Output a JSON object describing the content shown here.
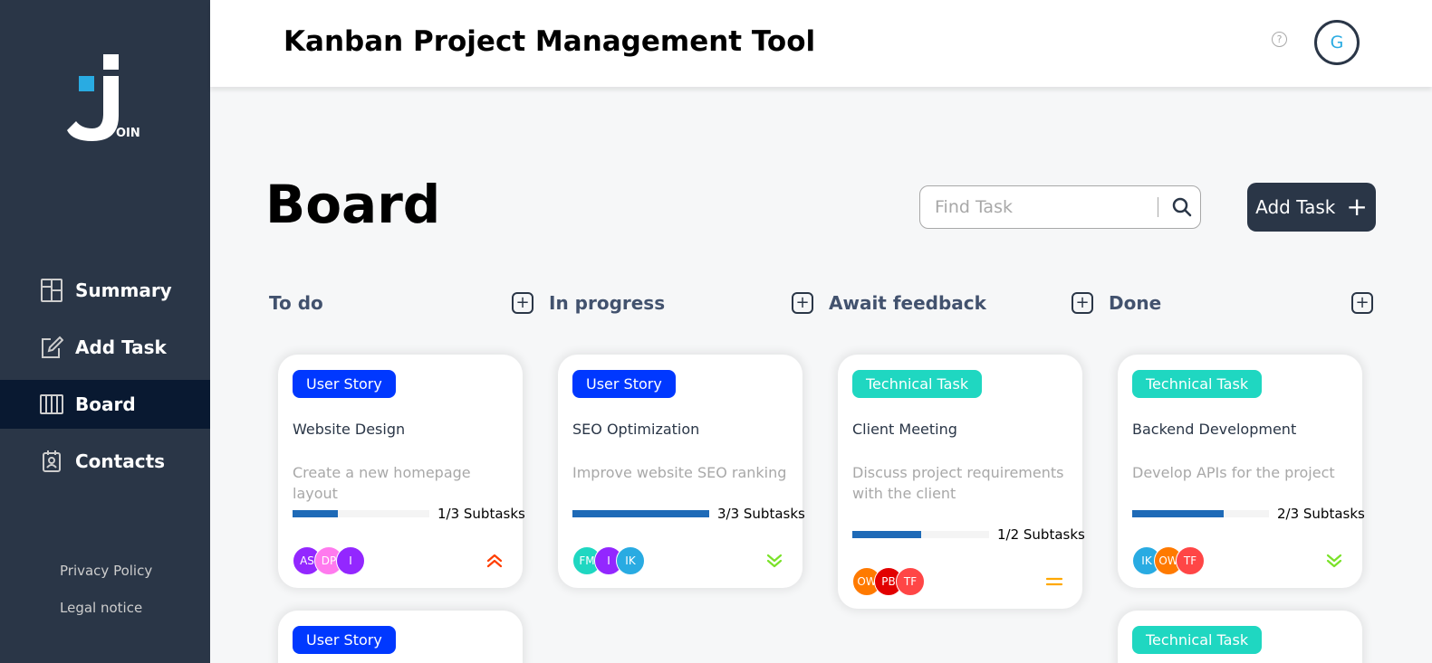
{
  "app": {
    "title": "Kanban Project Management Tool",
    "logo_text": "OIN",
    "help_label": "?",
    "user_initial": "G"
  },
  "sidebar": {
    "items": [
      {
        "label": "Summary",
        "icon": "summary-icon"
      },
      {
        "label": "Add Task",
        "icon": "add-task-icon"
      },
      {
        "label": "Board",
        "icon": "board-icon",
        "active": true
      },
      {
        "label": "Contacts",
        "icon": "contacts-icon"
      }
    ],
    "privacy_policy": "Privacy Policy",
    "legal_notice": "Legal notice"
  },
  "board": {
    "title": "Board",
    "search_placeholder": "Find Task",
    "add_task_label": "Add Task",
    "add_task_symbol": "+"
  },
  "colors": {
    "sidebar_bg": "#2a3647",
    "active_nav": "#091931",
    "user_story": "#0038ff",
    "technical_task": "#1fd7c1",
    "progress": "#1e6ab7",
    "prio_urgent": "#ff3d00",
    "prio_medium": "#ffa800",
    "prio_low": "#7ae229"
  },
  "columns": [
    {
      "title": "To do",
      "cards": [
        {
          "category": "User Story",
          "title": "Website Design",
          "description": "Create a new homepage layout",
          "progress": 0.333,
          "subtasks": "1/3 Subtasks",
          "priority": "urgent",
          "assignees": [
            {
              "initials": "AS",
              "color": "#9327ff"
            },
            {
              "initials": "DP",
              "color": "#ff7aee"
            },
            {
              "initials": "I",
              "color": "#9327ff"
            }
          ]
        },
        {
          "category": "User Story"
        }
      ]
    },
    {
      "title": "In progress",
      "cards": [
        {
          "category": "User Story",
          "title": "SEO Optimization",
          "description": "Improve website SEO ranking",
          "progress": 1.0,
          "subtasks": "3/3 Subtasks",
          "priority": "low",
          "assignees": [
            {
              "initials": "FM",
              "color": "#1fd7c1"
            },
            {
              "initials": "I",
              "color": "#9327ff"
            },
            {
              "initials": "IK",
              "color": "#29abe2"
            }
          ]
        }
      ]
    },
    {
      "title": "Await feedback",
      "cards": [
        {
          "category": "Technical Task",
          "title": "Client Meeting",
          "description": "Discuss project requirements with the client",
          "progress": 0.5,
          "subtasks": "1/2 Subtasks",
          "priority": "medium",
          "assignees": [
            {
              "initials": "OW",
              "color": "#ff7a00"
            },
            {
              "initials": "PB",
              "color": "#e20000"
            },
            {
              "initials": "TF",
              "color": "#ff4646"
            }
          ]
        }
      ]
    },
    {
      "title": "Done",
      "cards": [
        {
          "category": "Technical Task",
          "title": "Backend Development",
          "description": "Develop APIs for the project",
          "progress": 0.667,
          "subtasks": "2/3 Subtasks",
          "priority": "low",
          "assignees": [
            {
              "initials": "IK",
              "color": "#29abe2"
            },
            {
              "initials": "OW",
              "color": "#ff7a00"
            },
            {
              "initials": "TF",
              "color": "#ff4646"
            }
          ]
        },
        {
          "category": "Technical Task"
        }
      ]
    }
  ],
  "column_add_symbol": "+"
}
